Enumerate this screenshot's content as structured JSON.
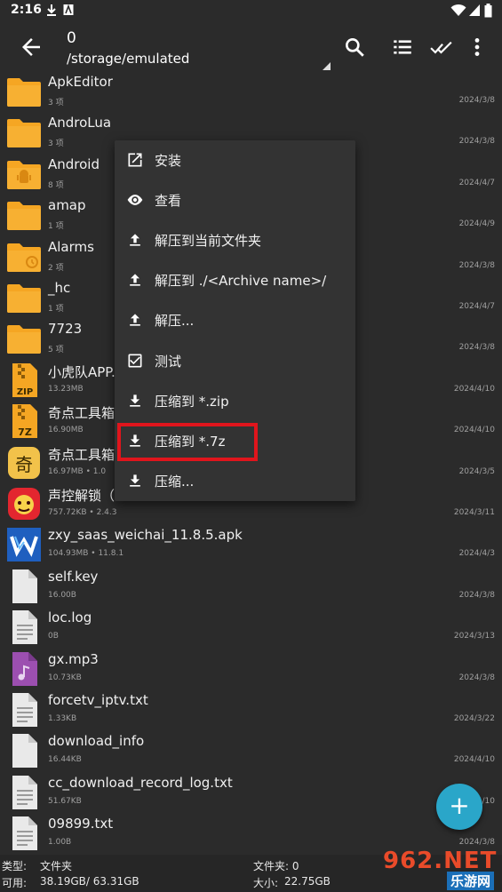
{
  "status_bar": {
    "time": "2:16"
  },
  "toolbar": {
    "count": "0",
    "path": "/storage/emulated",
    "icons": [
      "back-arrow-icon",
      "search-icon",
      "list-view-icon",
      "select-all-icon",
      "more-vert-icon"
    ]
  },
  "files": [
    {
      "name": "ApkEditor",
      "meta": "3 项",
      "date": "2024/3/8",
      "icon": "folder"
    },
    {
      "name": "AndroLua",
      "meta": "3 项",
      "date": "2024/3/8",
      "icon": "folder"
    },
    {
      "name": "Android",
      "meta": "8 项",
      "date": "2024/4/7",
      "icon": "folder-android"
    },
    {
      "name": "amap",
      "meta": "1 项",
      "date": "2024/4/9",
      "icon": "folder"
    },
    {
      "name": "Alarms",
      "meta": "2 项",
      "date": "2024/3/8",
      "icon": "folder-alarm"
    },
    {
      "name": "_hc",
      "meta": "1 项",
      "date": "2024/4/7",
      "icon": "folder"
    },
    {
      "name": "7723",
      "meta": "5 项",
      "date": "2024/3/8",
      "icon": "folder"
    },
    {
      "name": "小虎队APP.",
      "meta": "13.23MB",
      "date": "2024/4/10",
      "icon": "zip"
    },
    {
      "name": "奇点工具箱",
      "meta": "16.90MB",
      "date": "2024/4/10",
      "icon": "7z"
    },
    {
      "name": "奇点工具箱",
      "meta": "16.97MB  •  1.0",
      "date": "2024/3/5",
      "icon": "app-qi"
    },
    {
      "name": "声控解锁（",
      "meta": "757.72KB  •  2.4.3",
      "date": "2024/3/11",
      "icon": "app-red"
    },
    {
      "name": "zxy_saas_weichai_11.8.5.apk",
      "meta": "104.93MB  •  11.8.1",
      "date": "2024/4/3",
      "icon": "app-blue"
    },
    {
      "name": "self.key",
      "meta": "16.00B",
      "date": "2024/3/8",
      "icon": "file"
    },
    {
      "name": "loc.log",
      "meta": "0B",
      "date": "2024/3/13",
      "icon": "text"
    },
    {
      "name": "gx.mp3",
      "meta": "10.73KB",
      "date": "2024/3/8",
      "icon": "audio"
    },
    {
      "name": "forcetv_iptv.txt",
      "meta": "1.33KB",
      "date": "2024/3/22",
      "icon": "text"
    },
    {
      "name": "download_info",
      "meta": "16.44KB",
      "date": "2024/4/10",
      "icon": "file"
    },
    {
      "name": "cc_download_record_log.txt",
      "meta": "51.67KB",
      "date": "2024/4/10",
      "icon": "text"
    },
    {
      "name": "09899.txt",
      "meta": "1.00B",
      "date": "2024/3/8",
      "icon": "text"
    }
  ],
  "menu": [
    {
      "label": "安装",
      "icon": "open-external-icon"
    },
    {
      "label": "查看",
      "icon": "eye-icon"
    },
    {
      "label": "解压到当前文件夹",
      "icon": "upload-icon"
    },
    {
      "label": "解压到 ./<Archive name>/",
      "icon": "upload-icon"
    },
    {
      "label": "解压...",
      "icon": "upload-icon"
    },
    {
      "label": "测试",
      "icon": "checkbox-icon"
    },
    {
      "label": "压缩到 *.zip",
      "icon": "download-icon"
    },
    {
      "label": "压缩到 *.7z",
      "icon": "download-icon"
    },
    {
      "label": "压缩...",
      "icon": "download-icon"
    }
  ],
  "fab": {
    "label": "+"
  },
  "bottom": {
    "type_label": "类型:",
    "type_value": "文件夹",
    "avail_label": "可用:",
    "avail_value": "38.19GB/ 63.31GB",
    "folder_label": "文件夹: 0",
    "size_label": "大小:",
    "size_value": "22.75GB"
  },
  "watermark": {
    "big": "962.NET",
    "small": "乐游网"
  },
  "colors": {
    "background": "#2b2b2b",
    "folder": "#f5a623",
    "accent": "#2aa6c9",
    "highlight": "#e0151c"
  }
}
